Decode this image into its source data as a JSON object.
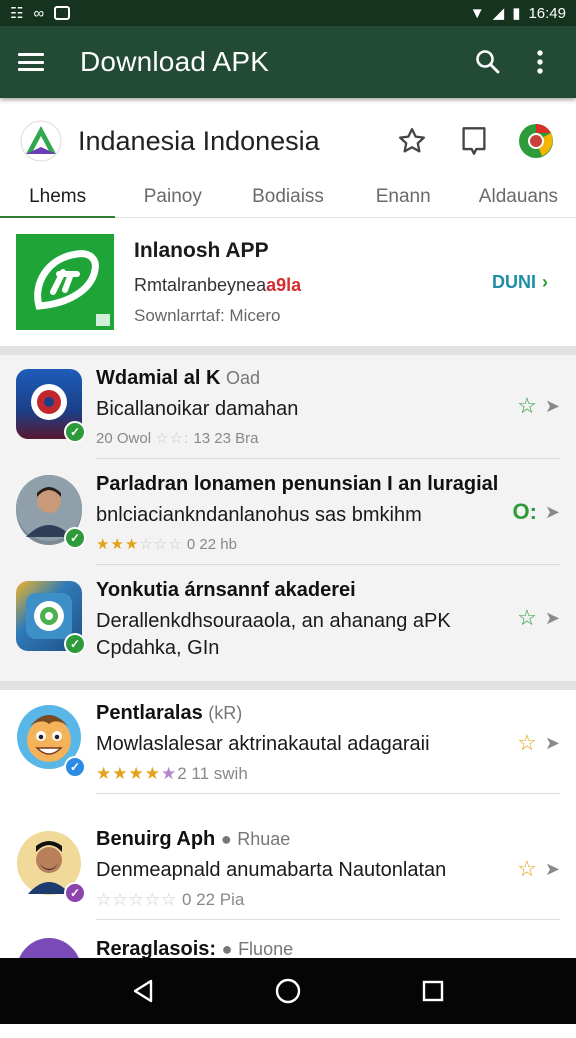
{
  "status_bar": {
    "left_icons": [
      "grid-icon",
      "infinity-icon",
      "notification-icon"
    ],
    "time": "16:49"
  },
  "app_bar": {
    "title": "Download APK"
  },
  "header": {
    "title": "Indanesia Indonesia",
    "tabs": [
      {
        "label": "Lhems",
        "active": true
      },
      {
        "label": "Painoy",
        "active": false
      },
      {
        "label": "Bodiaiss",
        "active": false
      },
      {
        "label": "Enann",
        "active": false
      },
      {
        "label": "Aldauans",
        "active": false
      }
    ]
  },
  "featured": {
    "name": "Inlanosh APP",
    "subtitle": "Rmtalranbeynea",
    "subtitle_highlight": "a9la",
    "meta": "Sownlarrtaf: Micero",
    "action": "DUNI"
  },
  "section1": {
    "items": [
      {
        "title": "Wdamial al K",
        "tag": "Oad",
        "desc": "Bicallanoikar damahan",
        "desc2": "",
        "meta_prefix": "20 Owol ",
        "rating": 1,
        "meta": "13 23 Bra",
        "action_color": "#2e9b3a",
        "icon": "camera-icon"
      },
      {
        "title": "Parladran lonamen penunsian I an luragial",
        "tag": "",
        "desc": "bnlciaciankndanlanohus sas bmkihm",
        "desc2": "",
        "meta_prefix": "",
        "rating": 3,
        "meta": "0 22 hb",
        "action_color": "#2e9b3a",
        "icon": "person-photo"
      },
      {
        "title": "Yonkutia árnsannf akaderei",
        "tag": "",
        "desc": "Derallenkdhsouraaola, an ahanang aPK",
        "desc2": "Cpdahka, GIn",
        "meta_prefix": "",
        "rating": 0,
        "meta": "",
        "action_color": "#2e9b3a",
        "icon": "android-icon"
      }
    ]
  },
  "section2": {
    "items": [
      {
        "title": "Pentlaralas",
        "tag": "(kR)",
        "desc": "Mowlaslalesar aktrinakautal adagaraii",
        "meta_prefix": "",
        "rating": 4,
        "meta": "2 11 swih",
        "action_color": "#e3a21a",
        "icon": "cartoon-face"
      },
      {
        "title": "Benuirg Aph",
        "tag": "Rhuae",
        "desc": "Denmeapnald anumabarta Nautonlatan",
        "meta_prefix": "",
        "rating": 1,
        "meta": "0 22 Pia",
        "action_color": "#e3a21a",
        "icon": "person-portrait"
      },
      {
        "title": "Reraglasois:",
        "tag": "Fluone",
        "desc": "",
        "meta_prefix": "",
        "rating": 0,
        "meta": "",
        "action_color": "#e3a21a",
        "icon": "purple-avatar"
      }
    ]
  }
}
